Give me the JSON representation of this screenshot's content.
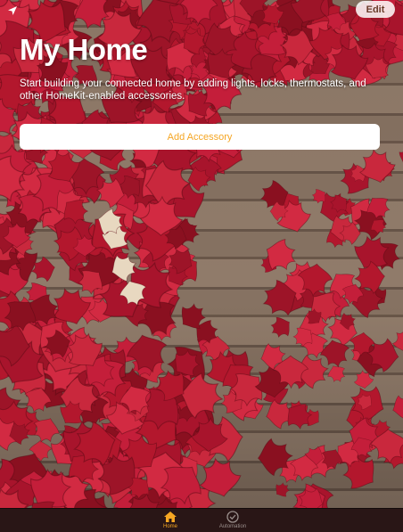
{
  "header": {
    "edit_label": "Edit",
    "location_icon": "location-arrow-icon"
  },
  "main": {
    "title": "My Home",
    "subtitle": "Start building your connected home by adding lights, locks, thermostats, and other HomeKit-enabled accessories.",
    "add_button_label": "Add Accessory"
  },
  "tabbar": {
    "tabs": [
      {
        "label": "Home",
        "icon": "house-icon",
        "active": true
      },
      {
        "label": "Automation",
        "icon": "clock-check-icon",
        "active": false
      }
    ]
  },
  "colors": {
    "accent": "#f5a623",
    "tabbar_bg": "#281616"
  }
}
